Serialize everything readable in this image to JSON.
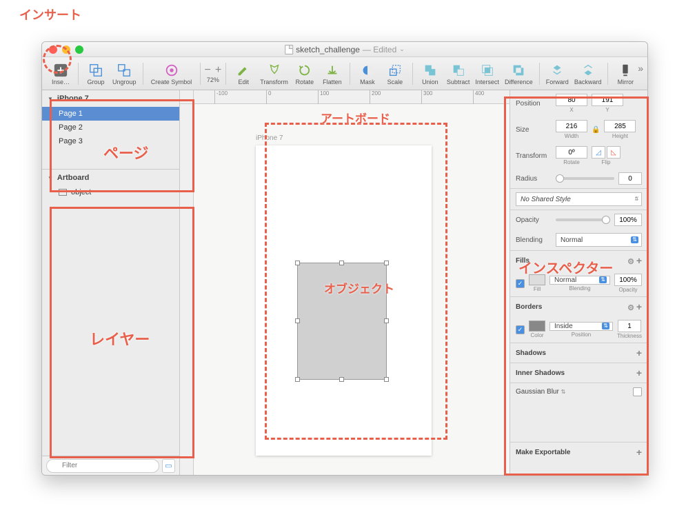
{
  "annotations": {
    "insert": "インサート",
    "pages": "ページ",
    "layers": "レイヤー",
    "artboard": "アートボード",
    "object": "オブジェクト",
    "inspector": "インスペクター"
  },
  "window": {
    "filename": "sketch_challenge",
    "edited": "— Edited"
  },
  "toolbar": {
    "insert": "Inse…",
    "group": "Group",
    "ungroup": "Ungroup",
    "create_symbol": "Create Symbol",
    "zoom_value": "72%",
    "edit": "Edit",
    "transform": "Transform",
    "rotate": "Rotate",
    "flatten": "Flatten",
    "mask": "Mask",
    "scale": "Scale",
    "union": "Union",
    "subtract": "Subtract",
    "intersect": "Intersect",
    "difference": "Difference",
    "forward": "Forward",
    "backward": "Backward",
    "mirror": "Mirror"
  },
  "ruler_ticks": [
    "-100",
    "0",
    "100",
    "200",
    "300",
    "400"
  ],
  "sidebar": {
    "doc_header": "iPhone 7",
    "pages": [
      "Page 1",
      "Page 2",
      "Page 3"
    ],
    "artboard_header": "Artboard",
    "layers": [
      "object"
    ],
    "filter_placeholder": "Filter"
  },
  "artboard_label": "iPhone 7",
  "inspector": {
    "position_label": "Position",
    "x_val": "80",
    "x_lbl": "X",
    "y_val": "191",
    "y_lbl": "Y",
    "size_label": "Size",
    "w_val": "216",
    "w_lbl": "Width",
    "h_val": "285",
    "h_lbl": "Height",
    "transform_label": "Transform",
    "rotate_val": "0º",
    "rotate_lbl": "Rotate",
    "flip_lbl": "Flip",
    "radius_label": "Radius",
    "radius_val": "0",
    "shared_style": "No Shared Style",
    "opacity_label": "Opacity",
    "opacity_val": "100%",
    "blending_label": "Blending",
    "blending_val": "Normal",
    "fills_header": "Fills",
    "fill_blend": "Normal",
    "fill_opacity": "100%",
    "fill_lbl": "Fill",
    "fill_blend_lbl": "Blending",
    "fill_opacity_lbl": "Opacity",
    "borders_header": "Borders",
    "border_pos": "Inside",
    "border_thickness": "1",
    "border_color_lbl": "Color",
    "border_pos_lbl": "Position",
    "border_thick_lbl": "Thickness",
    "shadows_header": "Shadows",
    "inner_shadows_header": "Inner Shadows",
    "gaussian_header": "Gaussian Blur",
    "exportable": "Make Exportable"
  }
}
